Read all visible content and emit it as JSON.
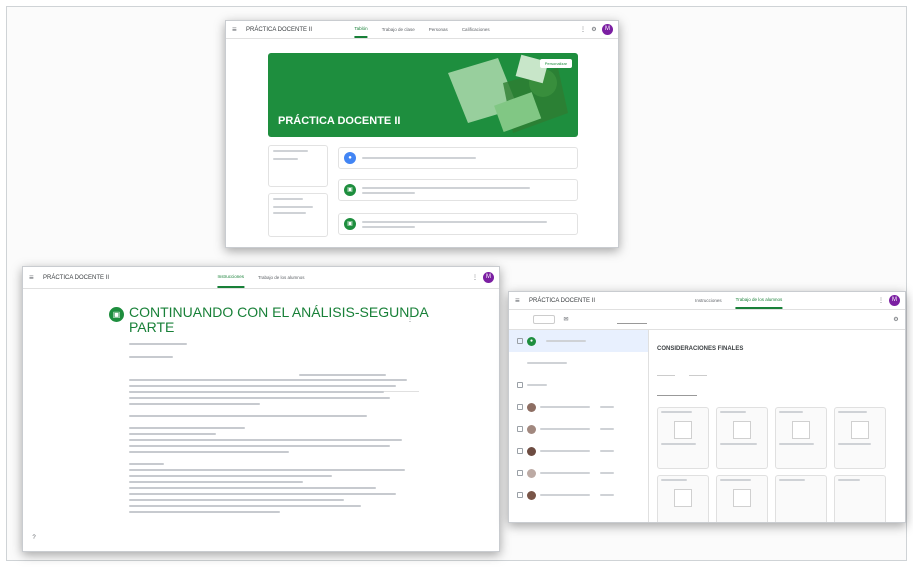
{
  "class_name": "PRÁCTICA DOCENTE II",
  "screen1": {
    "tabs": [
      "Tablón",
      "Trabajo de clase",
      "Personas",
      "Calificaciones"
    ],
    "banner_title": "PRÁCTICA DOCENTE II",
    "customize_label": "Personalizar"
  },
  "screen2": {
    "tabs": [
      "Instrucciones",
      "Trabajo de los alumnos"
    ],
    "assignment_title": "CONTINUANDO CON EL ANÁLISIS-SEGUNDA PARTE"
  },
  "screen3": {
    "tabs": [
      "Instrucciones",
      "Trabajo de los alumnos"
    ],
    "section_heading": "CONSIDERACIONES FINALES"
  },
  "colors": {
    "accent": "#1e8e3e",
    "avatar": "#7b1fa2"
  }
}
